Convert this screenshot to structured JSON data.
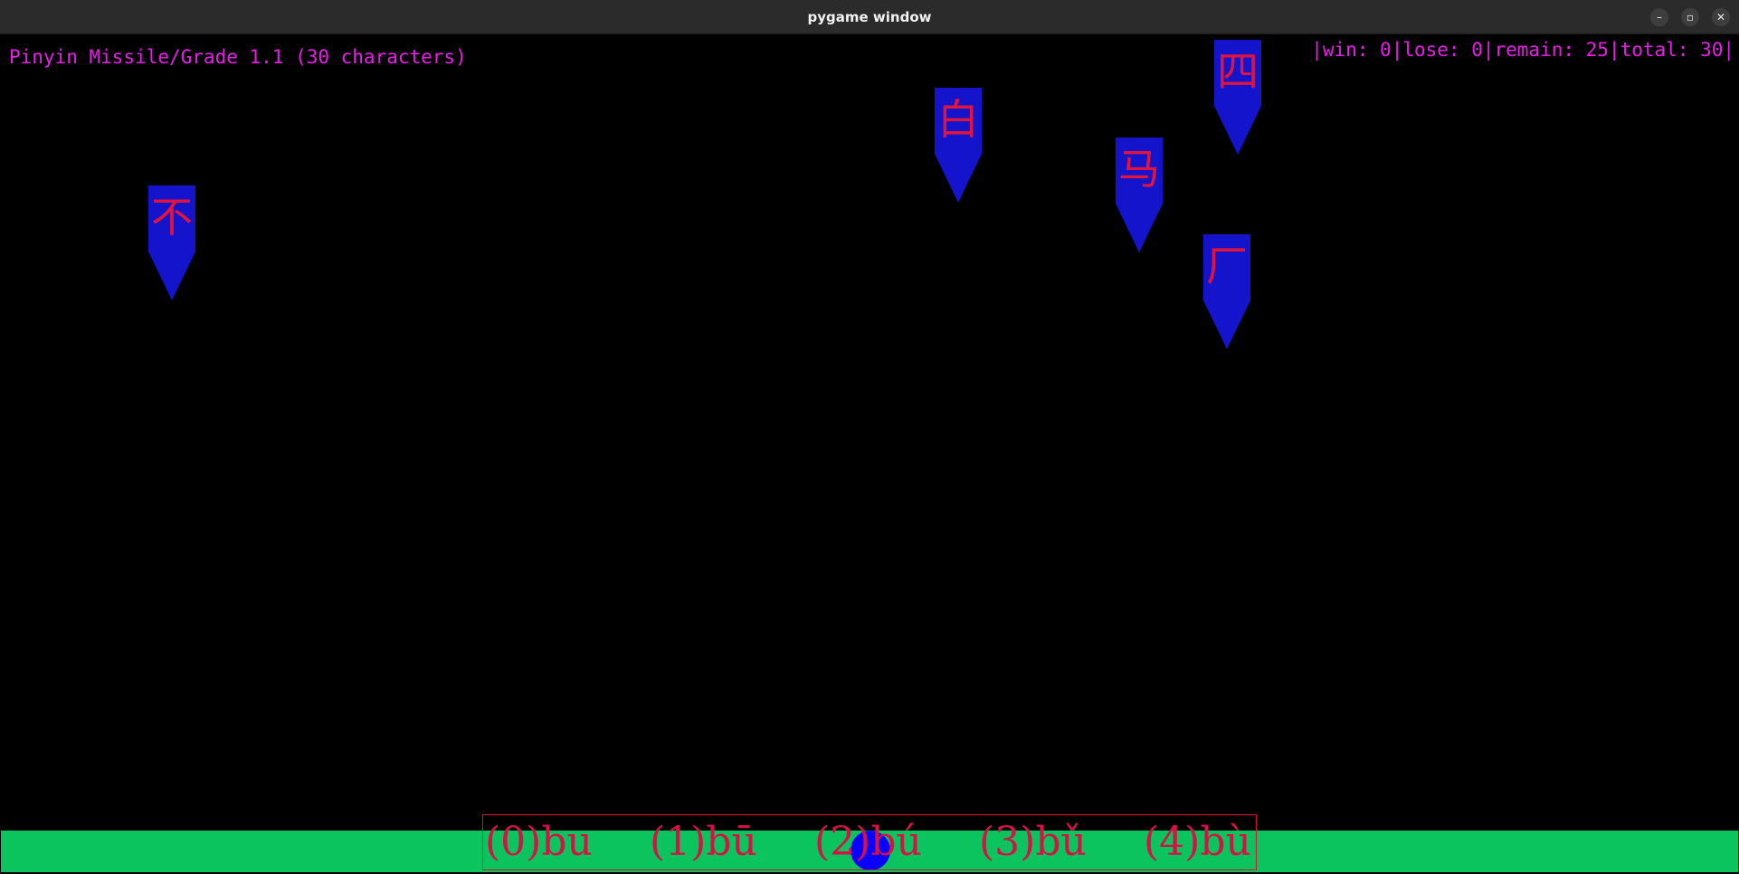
{
  "window": {
    "title": "pygame window",
    "buttons": {
      "minimize": "–",
      "maximize": "▫",
      "close": "✕"
    }
  },
  "hud": {
    "title": "Pinyin Missile/Grade 1.1 (30 characters)",
    "score": "|win: 0|lose: 0|remain: 25|total: 30|"
  },
  "missiles": [
    {
      "char": "不"
    },
    {
      "char": "白"
    },
    {
      "char": "马"
    },
    {
      "char": "四"
    },
    {
      "char": "厂"
    }
  ],
  "choices": [
    {
      "label": "(0)bu"
    },
    {
      "label": "(1)bū"
    },
    {
      "label": "(2)bú"
    },
    {
      "label": "(3)bǔ"
    },
    {
      "label": "(4)bù"
    }
  ],
  "colors": {
    "hud_text": "#e61ee6",
    "missile_body": "#1414cc",
    "missile_char": "#e0143c",
    "ground": "#0cc45e",
    "choice_text": "#d41246",
    "cannon": "#0a00ff"
  }
}
